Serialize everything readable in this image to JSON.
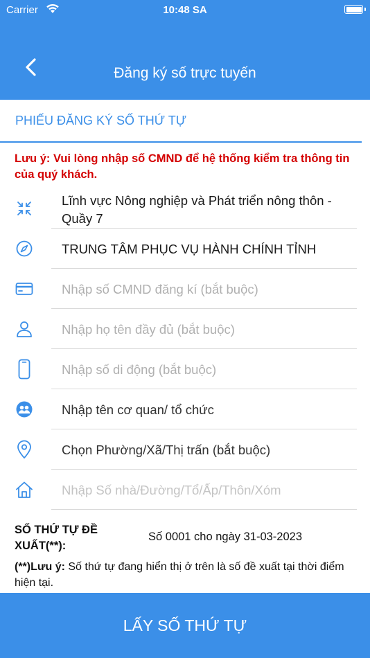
{
  "status_bar": {
    "carrier": "Carrier",
    "time": "10:48 SA"
  },
  "header": {
    "title": "Đăng ký số trực tuyến",
    "back_icon": "chevron-left-icon"
  },
  "form": {
    "section_title": "PHIẾU ĐĂNG KÝ SỐ THỨ TỰ",
    "notice": "Lưu ý: Vui lòng nhập số CMND để hệ thống kiểm tra thông tin của quý khách.",
    "fields": [
      {
        "icon": "compress-arrows-icon",
        "value": "Lĩnh vực Nông nghiệp và Phát triển nông thôn - Quầy 7",
        "placeholder": ""
      },
      {
        "icon": "compass-icon",
        "value": "TRUNG TÂM PHỤC VỤ HÀNH CHÍNH TỈNH",
        "placeholder": ""
      },
      {
        "icon": "id-card-icon",
        "value": "",
        "placeholder": "Nhập số CMND đăng kí (bắt buộc)"
      },
      {
        "icon": "user-icon",
        "value": "",
        "placeholder": "Nhập họ tên đầy đủ (bắt buộc)"
      },
      {
        "icon": "mobile-phone-icon",
        "value": "",
        "placeholder": "Nhập số di động (bắt buộc)"
      },
      {
        "icon": "organization-icon",
        "value": "",
        "placeholder": "Nhập tên cơ quan/ tổ chức"
      },
      {
        "icon": "location-pin-icon",
        "value": "",
        "placeholder": "Chọn Phường/Xã/Thị trấn (bắt buộc)"
      },
      {
        "icon": "home-icon",
        "value": "",
        "placeholder": "Nhập Số nhà/Đường/Tổ/Ấp/Thôn/Xóm"
      }
    ]
  },
  "proposal": {
    "label": "SỐ THỨ TỰ ĐỀ XUẤT(**):",
    "value": "Số 0001 cho ngày 31-03-2023"
  },
  "footnote": {
    "prefix": "(**)Lưu ý:",
    "text": " Số thứ tự đang hiển thị ở trên là số đề xuất tại thời điểm hiện tại."
  },
  "submit_label": "LẤY SỐ THỨ TỰ",
  "colors": {
    "primary": "#3b8fe8",
    "notice": "#d40000",
    "placeholder": "#b0b0b0"
  }
}
